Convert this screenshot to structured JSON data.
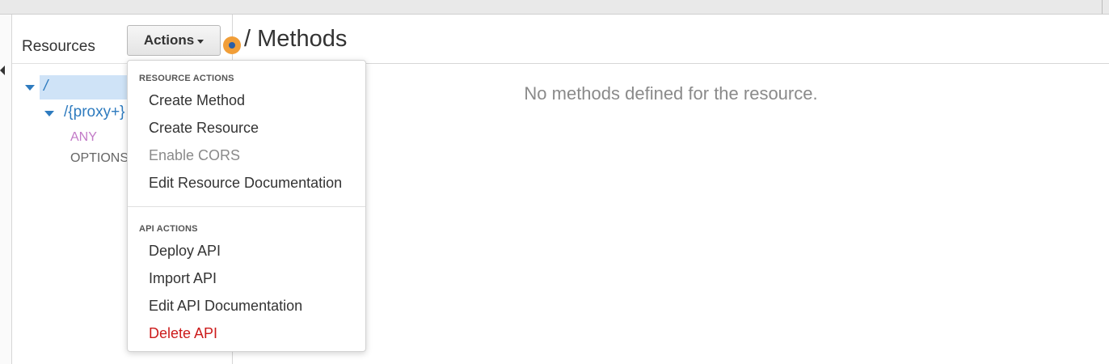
{
  "panel": {
    "title": "Resources",
    "actions_label": "Actions"
  },
  "tree": {
    "root": "/",
    "proxy": "/{proxy+}",
    "methods": [
      "ANY",
      "OPTIONS"
    ]
  },
  "main": {
    "title": "/ Methods",
    "empty_message": "No methods defined for the resource."
  },
  "dropdown": {
    "resource_section": "RESOURCE ACTIONS",
    "resource_items": [
      {
        "label": "Create Method",
        "state": "enabled"
      },
      {
        "label": "Create Resource",
        "state": "enabled"
      },
      {
        "label": "Enable CORS",
        "state": "disabled"
      },
      {
        "label": "Edit Resource Documentation",
        "state": "enabled"
      }
    ],
    "api_section": "API ACTIONS",
    "api_items": [
      {
        "label": "Deploy API",
        "state": "enabled"
      },
      {
        "label": "Import API",
        "state": "enabled"
      },
      {
        "label": "Edit API Documentation",
        "state": "enabled"
      },
      {
        "label": "Delete API",
        "state": "danger"
      }
    ]
  },
  "colors": {
    "link_blue": "#2e7bbf",
    "selected_row": "#cfe3f7",
    "method_any": "#c27ac7",
    "danger": "#cc1b1b",
    "dot_orange": "#f19e38"
  },
  "icons": [
    "collapse-left-icon",
    "expand-down-icon",
    "caret-down-icon",
    "help-dot-icon"
  ]
}
